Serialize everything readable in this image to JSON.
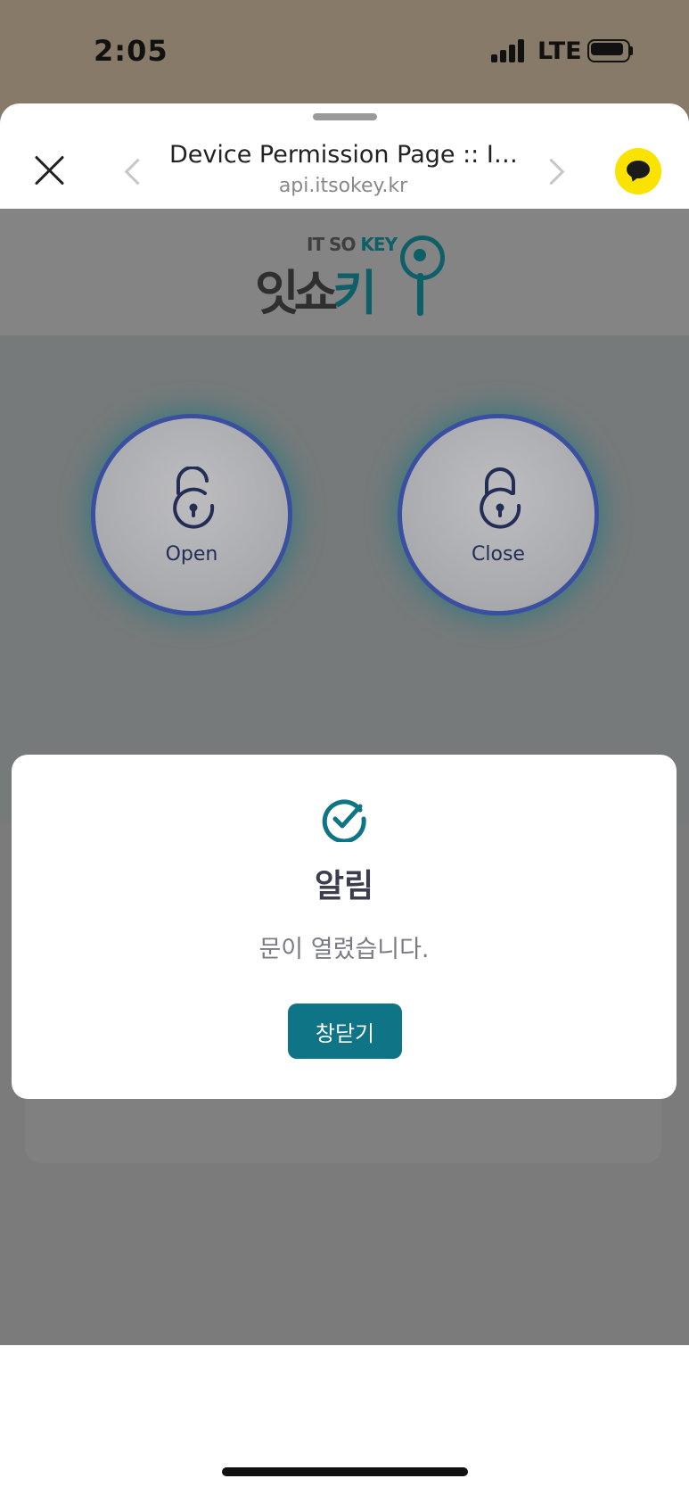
{
  "status_bar": {
    "time": "2:05",
    "network": "LTE"
  },
  "browser": {
    "title": "Device Permission Page :: I…",
    "url": "api.itsokey.kr"
  },
  "logo": {
    "small": "IT SO",
    "small_accent": "KEY",
    "main": "잇쇼",
    "main_accent": "키"
  },
  "controls": {
    "open_label": "Open",
    "close_label": "Close"
  },
  "modal": {
    "title": "알림",
    "message": "문이 열렸습니다.",
    "button": "창닫기"
  },
  "colors": {
    "accent": "#0e7486",
    "kakao": "#fae300",
    "ring": "#3a4fa0"
  }
}
